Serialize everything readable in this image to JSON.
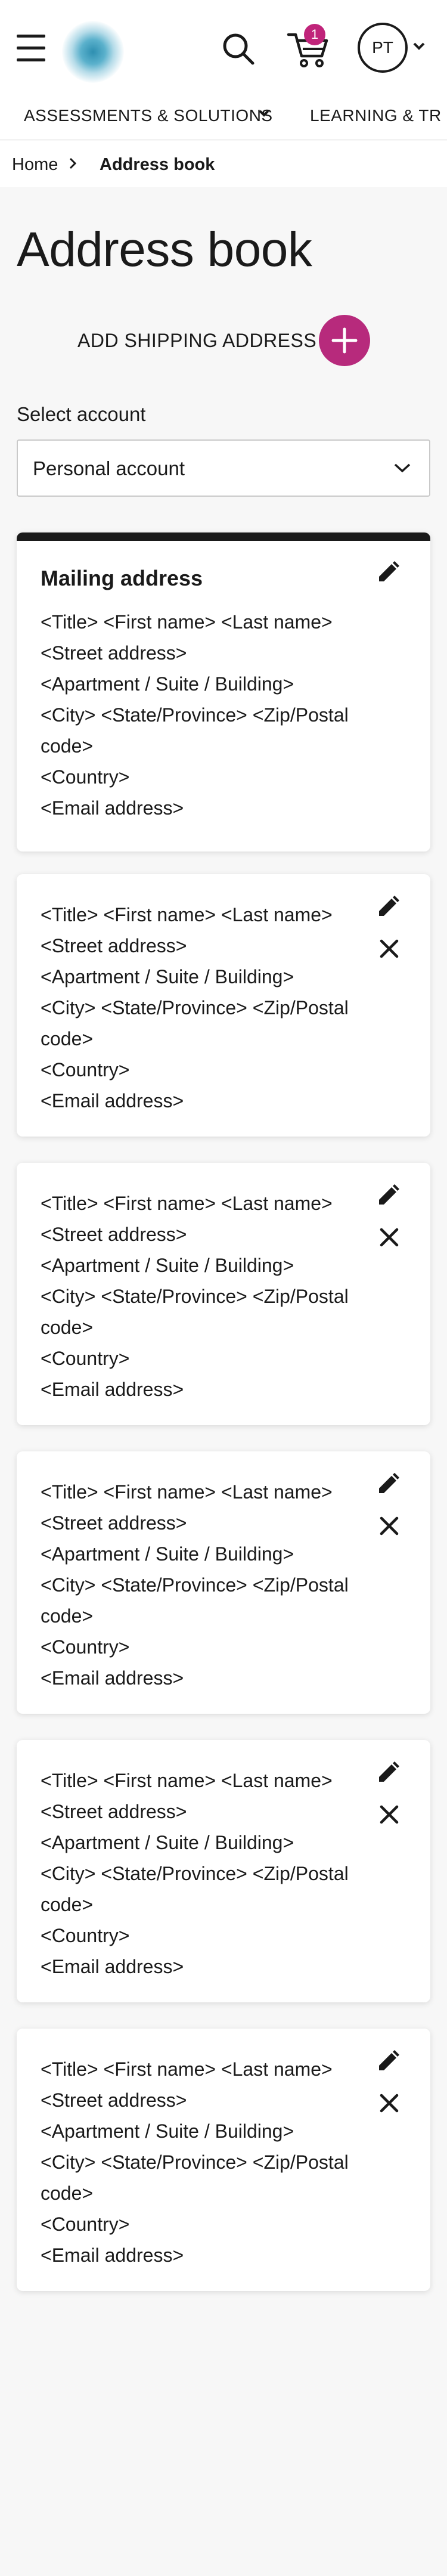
{
  "header": {
    "menu_icon": "hamburger-menu-icon",
    "search_icon": "search-icon",
    "cart_icon": "cart-icon",
    "cart_count": "1",
    "avatar_initials": "PT",
    "badge_color": "#c0247a"
  },
  "nav": {
    "items": [
      "ASSESSMENTS & SOLUTIONS",
      "LEARNING & TR"
    ]
  },
  "breadcrumb": {
    "home": "Home",
    "current": "Address book"
  },
  "page": {
    "title": "Address book",
    "add_label": "ADD SHIPPING ADDRESS",
    "add_color": "#b72a7c"
  },
  "account": {
    "label": "Select account",
    "value": "Personal account"
  },
  "cards": [
    {
      "title": "Mailing address",
      "lines": [
        "<Title> <First name> <Last name>",
        "<Street address>",
        "<Apartment / Suite / Building>",
        "<City> <State/Province> <Zip/Postal",
        "code>",
        "<Country>",
        "<Email address>"
      ]
    },
    {
      "lines": [
        "<Title> <First name> <Last name>",
        "<Street address>",
        "<Apartment / Suite / Building>",
        "<City> <State/Province> <Zip/Postal",
        "code>",
        "<Country>",
        "<Email address>"
      ]
    },
    {
      "lines": [
        "<Title> <First name> <Last name>",
        "<Street address>",
        "<Apartment / Suite / Building>",
        "<City> <State/Province> <Zip/Postal",
        "code>",
        "<Country>",
        "<Email address>"
      ]
    },
    {
      "lines": [
        "<Title> <First name> <Last name>",
        "<Street address>",
        "<Apartment / Suite / Building>",
        "<City> <State/Province> <Zip/Postal",
        "code>",
        "<Country>",
        "<Email address>"
      ]
    },
    {
      "lines": [
        "<Title> <First name> <Last name>",
        "<Street address>",
        "<Apartment / Suite / Building>",
        "<City> <State/Province> <Zip/Postal",
        "code>",
        "<Country>",
        "<Email address>"
      ]
    },
    {
      "lines": [
        "<Title> <First name> <Last name>",
        "<Street address>",
        "<Apartment / Suite / Building>",
        "<City> <State/Province> <Zip/Postal",
        "code>",
        "<Country>",
        "<Email address>"
      ]
    }
  ]
}
